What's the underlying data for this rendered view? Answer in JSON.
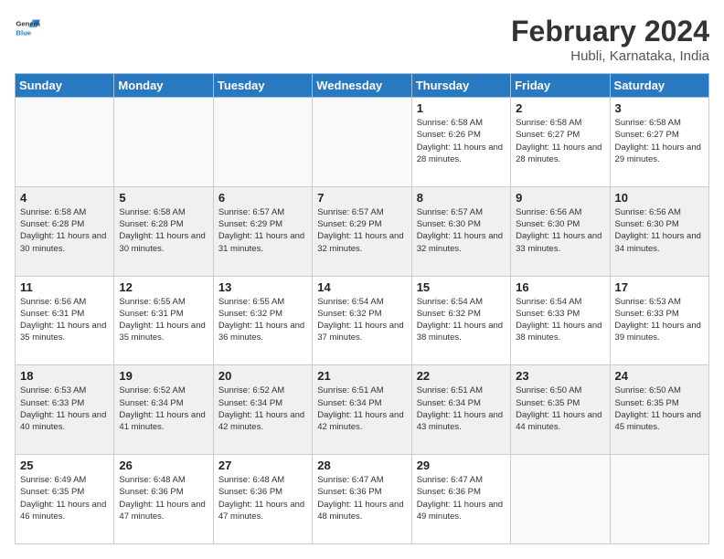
{
  "header": {
    "logo_line1": "General",
    "logo_line2": "Blue",
    "month_year": "February 2024",
    "location": "Hubli, Karnataka, India"
  },
  "weekdays": [
    "Sunday",
    "Monday",
    "Tuesday",
    "Wednesday",
    "Thursday",
    "Friday",
    "Saturday"
  ],
  "weeks": [
    [
      {
        "day": "",
        "info": ""
      },
      {
        "day": "",
        "info": ""
      },
      {
        "day": "",
        "info": ""
      },
      {
        "day": "",
        "info": ""
      },
      {
        "day": "1",
        "info": "Sunrise: 6:58 AM\nSunset: 6:26 PM\nDaylight: 11 hours and 28 minutes."
      },
      {
        "day": "2",
        "info": "Sunrise: 6:58 AM\nSunset: 6:27 PM\nDaylight: 11 hours and 28 minutes."
      },
      {
        "day": "3",
        "info": "Sunrise: 6:58 AM\nSunset: 6:27 PM\nDaylight: 11 hours and 29 minutes."
      }
    ],
    [
      {
        "day": "4",
        "info": "Sunrise: 6:58 AM\nSunset: 6:28 PM\nDaylight: 11 hours and 30 minutes."
      },
      {
        "day": "5",
        "info": "Sunrise: 6:58 AM\nSunset: 6:28 PM\nDaylight: 11 hours and 30 minutes."
      },
      {
        "day": "6",
        "info": "Sunrise: 6:57 AM\nSunset: 6:29 PM\nDaylight: 11 hours and 31 minutes."
      },
      {
        "day": "7",
        "info": "Sunrise: 6:57 AM\nSunset: 6:29 PM\nDaylight: 11 hours and 32 minutes."
      },
      {
        "day": "8",
        "info": "Sunrise: 6:57 AM\nSunset: 6:30 PM\nDaylight: 11 hours and 32 minutes."
      },
      {
        "day": "9",
        "info": "Sunrise: 6:56 AM\nSunset: 6:30 PM\nDaylight: 11 hours and 33 minutes."
      },
      {
        "day": "10",
        "info": "Sunrise: 6:56 AM\nSunset: 6:30 PM\nDaylight: 11 hours and 34 minutes."
      }
    ],
    [
      {
        "day": "11",
        "info": "Sunrise: 6:56 AM\nSunset: 6:31 PM\nDaylight: 11 hours and 35 minutes."
      },
      {
        "day": "12",
        "info": "Sunrise: 6:55 AM\nSunset: 6:31 PM\nDaylight: 11 hours and 35 minutes."
      },
      {
        "day": "13",
        "info": "Sunrise: 6:55 AM\nSunset: 6:32 PM\nDaylight: 11 hours and 36 minutes."
      },
      {
        "day": "14",
        "info": "Sunrise: 6:54 AM\nSunset: 6:32 PM\nDaylight: 11 hours and 37 minutes."
      },
      {
        "day": "15",
        "info": "Sunrise: 6:54 AM\nSunset: 6:32 PM\nDaylight: 11 hours and 38 minutes."
      },
      {
        "day": "16",
        "info": "Sunrise: 6:54 AM\nSunset: 6:33 PM\nDaylight: 11 hours and 38 minutes."
      },
      {
        "day": "17",
        "info": "Sunrise: 6:53 AM\nSunset: 6:33 PM\nDaylight: 11 hours and 39 minutes."
      }
    ],
    [
      {
        "day": "18",
        "info": "Sunrise: 6:53 AM\nSunset: 6:33 PM\nDaylight: 11 hours and 40 minutes."
      },
      {
        "day": "19",
        "info": "Sunrise: 6:52 AM\nSunset: 6:34 PM\nDaylight: 11 hours and 41 minutes."
      },
      {
        "day": "20",
        "info": "Sunrise: 6:52 AM\nSunset: 6:34 PM\nDaylight: 11 hours and 42 minutes."
      },
      {
        "day": "21",
        "info": "Sunrise: 6:51 AM\nSunset: 6:34 PM\nDaylight: 11 hours and 42 minutes."
      },
      {
        "day": "22",
        "info": "Sunrise: 6:51 AM\nSunset: 6:34 PM\nDaylight: 11 hours and 43 minutes."
      },
      {
        "day": "23",
        "info": "Sunrise: 6:50 AM\nSunset: 6:35 PM\nDaylight: 11 hours and 44 minutes."
      },
      {
        "day": "24",
        "info": "Sunrise: 6:50 AM\nSunset: 6:35 PM\nDaylight: 11 hours and 45 minutes."
      }
    ],
    [
      {
        "day": "25",
        "info": "Sunrise: 6:49 AM\nSunset: 6:35 PM\nDaylight: 11 hours and 46 minutes."
      },
      {
        "day": "26",
        "info": "Sunrise: 6:48 AM\nSunset: 6:36 PM\nDaylight: 11 hours and 47 minutes."
      },
      {
        "day": "27",
        "info": "Sunrise: 6:48 AM\nSunset: 6:36 PM\nDaylight: 11 hours and 47 minutes."
      },
      {
        "day": "28",
        "info": "Sunrise: 6:47 AM\nSunset: 6:36 PM\nDaylight: 11 hours and 48 minutes."
      },
      {
        "day": "29",
        "info": "Sunrise: 6:47 AM\nSunset: 6:36 PM\nDaylight: 11 hours and 49 minutes."
      },
      {
        "day": "",
        "info": ""
      },
      {
        "day": "",
        "info": ""
      }
    ]
  ]
}
